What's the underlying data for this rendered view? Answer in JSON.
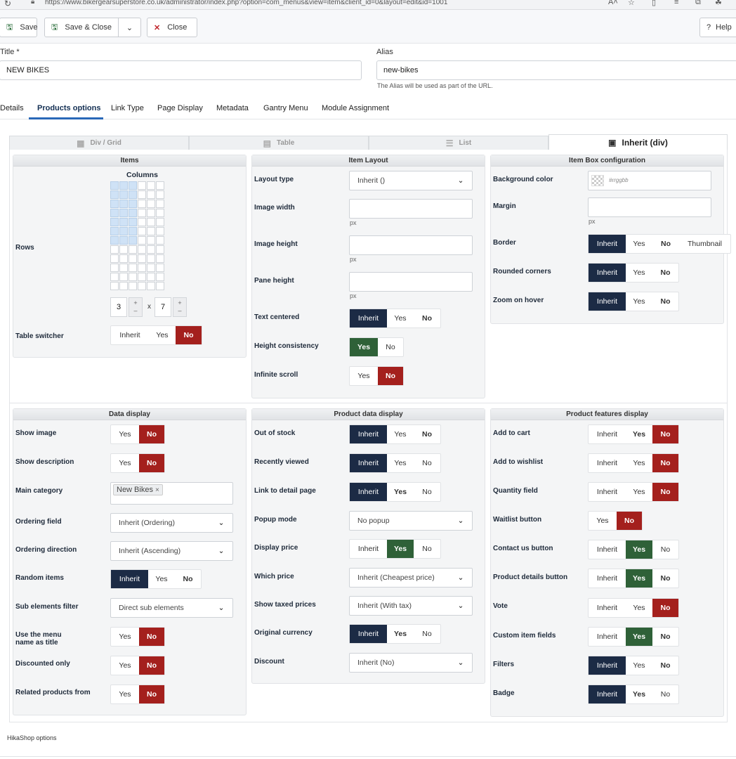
{
  "browser": {
    "url": "https://www.bikergearsuperstore.co.uk/administrator/index.php?option=com_menus&view=item&client_id=0&layout=edit&id=1001"
  },
  "toolbar": {
    "save": "Save",
    "save_close": "Save & Close",
    "close": "Close",
    "help": "Help"
  },
  "fields": {
    "title_label": "Title *",
    "title_value": "NEW BIKES",
    "alias_label": "Alias",
    "alias_value": "new-bikes",
    "alias_hint": "The Alias will be used as part of the URL."
  },
  "tabs": [
    "Details",
    "Products options",
    "Link Type",
    "Page Display",
    "Metadata",
    "Gantry Menu",
    "Module Assignment"
  ],
  "layout_tabs": [
    "Div / Grid",
    "Table",
    "List",
    "Inherit (div)"
  ],
  "items_panel": {
    "title": "Items",
    "columns_label": "Columns",
    "rows_label": "Rows",
    "rows_value": "3",
    "x": "x",
    "cols_value": "7",
    "table_switcher": "Table switcher",
    "table_switcher_opts": [
      "Inherit",
      "Yes",
      "No"
    ]
  },
  "item_layout": {
    "title": "Item Layout",
    "layout_type": "Layout type",
    "layout_type_value": "Inherit ()",
    "image_width": "Image width",
    "image_height": "Image height",
    "pane_height": "Pane height",
    "px": "px",
    "text_centered": "Text centered",
    "text_centered_opts": [
      "Inherit",
      "Yes",
      "No"
    ],
    "height_consistency": "Height consistency",
    "height_consistency_opts": [
      "Yes",
      "No"
    ],
    "infinite_scroll": "Infinite scroll",
    "infinite_scroll_opts": [
      "Yes",
      "No"
    ]
  },
  "item_box": {
    "title": "Item Box configuration",
    "background_color": "Background color",
    "bg_placeholder": "#rrggbb",
    "margin": "Margin",
    "px": "px",
    "border": "Border",
    "border_opts": [
      "Inherit",
      "Yes",
      "No",
      "Thumbnail"
    ],
    "rounded": "Rounded corners",
    "rounded_opts": [
      "Inherit",
      "Yes",
      "No"
    ],
    "zoom": "Zoom on hover",
    "zoom_opts": [
      "Inherit",
      "Yes",
      "No"
    ]
  },
  "data_display": {
    "title": "Data display",
    "show_image": "Show image",
    "show_description": "Show description",
    "main_category": "Main category",
    "main_category_tag": "New Bikes",
    "ordering_field": "Ordering field",
    "ordering_field_value": "Inherit (Ordering)",
    "ordering_direction": "Ordering direction",
    "ordering_direction_value": "Inherit (Ascending)",
    "random_items": "Random items",
    "sub_filter": "Sub elements filter",
    "sub_filter_value": "Direct sub elements",
    "use_menu_name_1": "Use the menu",
    "use_menu_name_2": "name as title",
    "discounted_only": "Discounted only",
    "related_from": "Related products from",
    "yes": "Yes",
    "no": "No",
    "inherit": "Inherit"
  },
  "product_data": {
    "title": "Product data display",
    "out_of_stock": "Out of stock",
    "recently_viewed": "Recently viewed",
    "link_detail": "Link to detail page",
    "popup_mode": "Popup mode",
    "popup_mode_value": "No popup",
    "display_price": "Display price",
    "which_price": "Which price",
    "which_price_value": "Inherit (Cheapest price)",
    "show_taxed": "Show taxed prices",
    "show_taxed_value": "Inherit (With tax)",
    "original_currency": "Original currency",
    "discount": "Discount",
    "discount_value": "Inherit (No)"
  },
  "product_features": {
    "title": "Product features display",
    "add_to_cart": "Add to cart",
    "add_to_wishlist": "Add to wishlist",
    "quantity_field": "Quantity field",
    "waitlist": "Waitlist button",
    "contact_us": "Contact us button",
    "product_details": "Product details button",
    "vote": "Vote",
    "custom_fields": "Custom item fields",
    "filters": "Filters",
    "badge": "Badge"
  },
  "footer": "HikaShop options",
  "colors": {
    "navy": "#1c2b45",
    "red": "#a4201d",
    "green": "#2f6138",
    "tab_accent": "#2a69b8"
  }
}
